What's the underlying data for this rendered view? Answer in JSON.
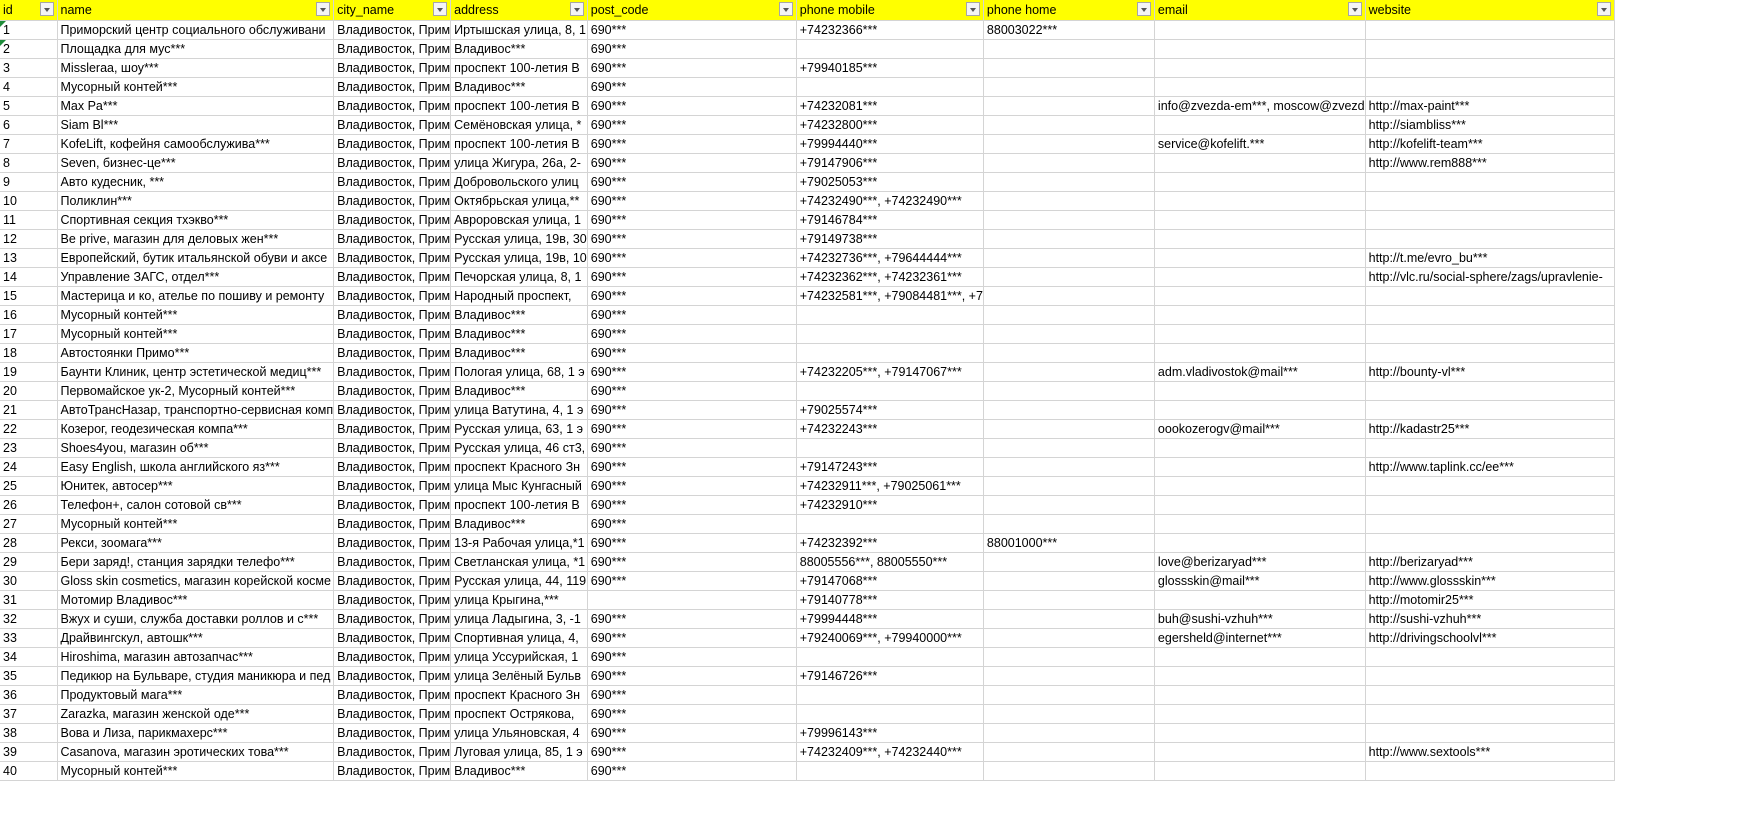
{
  "columns": [
    {
      "key": "id",
      "label": "id"
    },
    {
      "key": "name",
      "label": "name"
    },
    {
      "key": "city",
      "label": "city_name"
    },
    {
      "key": "address",
      "label": "address"
    },
    {
      "key": "post",
      "label": "post_code"
    },
    {
      "key": "mobile",
      "label": "phone mobile"
    },
    {
      "key": "home",
      "label": "phone home"
    },
    {
      "key": "email",
      "label": "email"
    },
    {
      "key": "website",
      "label": "website"
    }
  ],
  "rows": [
    [
      "1",
      "Приморский центр социального обслуживани",
      "Владивосток, Прим",
      "Иртышская улица, 8, 1",
      "690***",
      "+74232366***",
      "88003022***",
      "",
      ""
    ],
    [
      "2",
      "Площадка для мус***",
      "Владивосток, Прим",
      "Владивос***",
      "690***",
      "",
      "",
      "",
      ""
    ],
    [
      "3",
      "Missleraa, шоу***",
      "Владивосток, Прим",
      "проспект 100-летия В",
      "690***",
      "+79940185***",
      "",
      "",
      ""
    ],
    [
      "4",
      "Мусорный контей***",
      "Владивосток, Прим",
      "Владивос***",
      "690***",
      "",
      "",
      "",
      ""
    ],
    [
      "5",
      "Max Pa***",
      "Владивосток, Прим",
      "проспект 100-летия В",
      "690***",
      "+74232081***",
      "",
      "info@zvezda-em***, moscow@zvezd",
      "http://max-paint***"
    ],
    [
      "6",
      "Siam Bl***",
      "Владивосток, Прим",
      "Семёновская улица, *",
      "690***",
      "+74232800***",
      "",
      "",
      "http://siambliss***"
    ],
    [
      "7",
      "KofeLift, кофейня самообслужива***",
      "Владивосток, Прим",
      "проспект 100-летия В",
      "690***",
      "+79994440***",
      "",
      "service@kofelift.***",
      "http://kofelift-team***"
    ],
    [
      "8",
      "Seven, бизнес-це***",
      "Владивосток, Прим",
      "улица Жигура, 26а, 2-",
      "690***",
      "+79147906***",
      "",
      "",
      "http://www.rem888***"
    ],
    [
      "9",
      "Авто кудесник, ***",
      "Владивосток, Прим",
      "Добровольского улиц",
      "690***",
      "+79025053***",
      "",
      "",
      ""
    ],
    [
      "10",
      "Поликлин***",
      "Владивосток, Прим",
      "Октябрьская улица,**",
      "690***",
      "+74232490***, +74232490***",
      "",
      "",
      ""
    ],
    [
      "11",
      "Спортивная секция тхэкво***",
      "Владивосток, Прим",
      "Авроровская улица, 1",
      "690***",
      "+79146784***",
      "",
      "",
      ""
    ],
    [
      "12",
      "Be prive, магазин для деловых жен***",
      "Владивосток, Прим",
      "Русская улица, 19в, 30",
      "690***",
      "+79149738***",
      "",
      "",
      ""
    ],
    [
      "13",
      "Европейский, бутик итальянской обуви и аксе",
      "Владивосток, Прим",
      "Русская улица, 19в, 10",
      "690***",
      "+74232736***, +79644444***",
      "",
      "",
      "http://t.me/evro_bu***"
    ],
    [
      "14",
      "Управление ЗАГС, отдел***",
      "Владивосток, Прим",
      "Печорская улица, 8, 1",
      "690***",
      "+74232362***, +74232361***",
      "",
      "",
      "http://vlc.ru/social-sphere/zags/upravlenie-"
    ],
    [
      "15",
      "Мастерица и ко, ателье по пошиву и ремонту",
      "Владивосток, Прим",
      "Народный проспект,",
      "690***",
      "+74232581***, +79084481***, +7",
      "",
      "",
      ""
    ],
    [
      "16",
      "Мусорный контей***",
      "Владивосток, Прим",
      "Владивос***",
      "690***",
      "",
      "",
      "",
      ""
    ],
    [
      "17",
      "Мусорный контей***",
      "Владивосток, Прим",
      "Владивос***",
      "690***",
      "",
      "",
      "",
      ""
    ],
    [
      "18",
      "Автостоянки Примо***",
      "Владивосток, Прим",
      "Владивос***",
      "690***",
      "",
      "",
      "",
      ""
    ],
    [
      "19",
      "Баунти Клиник, центр эстетической медиц***",
      "Владивосток, Прим",
      "Пологая улица, 68, 1 э",
      "690***",
      "+74232205***, +79147067***",
      "",
      "adm.vladivostok@mail***",
      "http://bounty-vl***"
    ],
    [
      "20",
      "Первомайское ук-2, Мусорный контей***",
      "Владивосток, Прим",
      "Владивос***",
      "690***",
      "",
      "",
      "",
      ""
    ],
    [
      "21",
      "АвтоТрансНазар, транспортно-сервисная комп",
      "Владивосток, Прим",
      "улица Ватутина, 4, 1 э",
      "690***",
      "+79025574***",
      "",
      "",
      ""
    ],
    [
      "22",
      "Козерог, геодезическая компа***",
      "Владивосток, Прим",
      "Русская улица, 63, 1 э",
      "690***",
      "+74232243***",
      "",
      "oookozerogv@mail***",
      "http://kadastr25***"
    ],
    [
      "23",
      "Shoes4you, магазин об***",
      "Владивосток, Прим",
      "Русская улица, 46 ст3,",
      "690***",
      "",
      "",
      "",
      ""
    ],
    [
      "24",
      "Easy English, школа английского яз***",
      "Владивосток, Прим",
      "проспект Красного Зн",
      "690***",
      "+79147243***",
      "",
      "",
      "http://www.taplink.cc/ee***"
    ],
    [
      "25",
      "Юнитек, автосер***",
      "Владивосток, Прим",
      "улица Мыс Кунгасный",
      "690***",
      "+74232911***, +79025061***",
      "",
      "",
      ""
    ],
    [
      "26",
      "Телефон+, салон сотовой св***",
      "Владивосток, Прим",
      "проспект 100-летия В",
      "690***",
      "+74232910***",
      "",
      "",
      ""
    ],
    [
      "27",
      "Мусорный контей***",
      "Владивосток, Прим",
      "Владивос***",
      "690***",
      "",
      "",
      "",
      ""
    ],
    [
      "28",
      "Рекси, зоомага***",
      "Владивосток, Прим",
      "13-я Рабочая улица,*1",
      "690***",
      "+74232392***",
      "88001000***",
      "",
      ""
    ],
    [
      "29",
      "Бери заряд!, станция зарядки телефо***",
      "Владивосток, Прим",
      "Светланская улица, *1",
      "690***",
      "88005556***, 88005550***",
      "",
      "love@berizaryad***",
      "http://berizaryad***"
    ],
    [
      "30",
      "Gloss skin cosmetics, магазин корейской косме",
      "Владивосток, Прим",
      "Русская улица, 44, 119",
      "690***",
      "+79147068***",
      "",
      "glossskin@mail***",
      "http://www.glossskin***"
    ],
    [
      "31",
      "Мотомир Владивос***",
      "Владивосток, Прим",
      "улица Крыгина,***",
      "",
      "+79140778***",
      "",
      "",
      "http://motomir25***"
    ],
    [
      "32",
      "Вжух и суши, служба доставки роллов и с***",
      "Владивосток, Прим",
      "улица Ладыгина, 3, -1",
      "690***",
      "+79994448***",
      "",
      "buh@sushi-vzhuh***",
      "http://sushi-vzhuh***"
    ],
    [
      "33",
      "Драйвингскул, автошк***",
      "Владивосток, Прим",
      "Спортивная улица, 4,",
      "690***",
      "+79240069***, +79940000***",
      "",
      "egersheld@internet***",
      "http://drivingschoolvl***"
    ],
    [
      "34",
      "Hiroshima, магазин автозапчас***",
      "Владивосток, Прим",
      "улица Уссурийская, 1",
      "690***",
      "",
      "",
      "",
      ""
    ],
    [
      "35",
      "Педикюр на Бульваре, студия маникюра и пед",
      "Владивосток, Прим",
      "улица Зелёный Бульв",
      "690***",
      "+79146726***",
      "",
      "",
      ""
    ],
    [
      "36",
      "Продуктовый мага***",
      "Владивосток, Прим",
      "проспект Красного Зн",
      "690***",
      "",
      "",
      "",
      ""
    ],
    [
      "37",
      "Zarazka, магазин женской оде***",
      "Владивосток, Прим",
      "проспект Острякова,",
      "690***",
      "",
      "",
      "",
      ""
    ],
    [
      "38",
      "Вова и Лиза, парикмахерс***",
      "Владивосток, Прим",
      "улица Ульяновская, 4",
      "690***",
      "+79996143***",
      "",
      "",
      ""
    ],
    [
      "39",
      "Casanova, магазин эротических това***",
      "Владивосток, Прим",
      "Луговая улица, 85, 1 э",
      "690***",
      "+74232409***, +74232440***",
      "",
      "",
      "http://www.sextools***"
    ],
    [
      "40",
      "Мусорный контей***",
      "Владивосток, Прим",
      "Владивос***",
      "690***",
      "",
      "",
      "",
      ""
    ]
  ],
  "colors": {
    "header_bg": "#ffff00",
    "grid": "#d4d4d4",
    "comment_marker": "#1e8c3a"
  },
  "icons": {
    "filter": "filter-dropdown-icon",
    "comment": "comment-marker-icon"
  }
}
